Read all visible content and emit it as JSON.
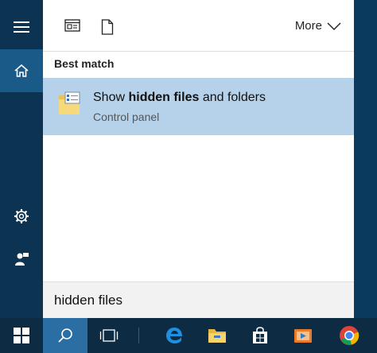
{
  "filters": {
    "apps_icon": "app-window-icon",
    "documents_icon": "document-icon",
    "more_label": "More"
  },
  "best_match": {
    "heading": "Best match",
    "result": {
      "title_prefix": "Show ",
      "title_bold": "hidden files",
      "title_suffix": " and folders",
      "subtitle": "Control panel",
      "icon": "folder-options-icon"
    }
  },
  "search": {
    "query": "hidden files"
  },
  "rail": {
    "items": [
      "hamburger-menu-icon",
      "home-icon",
      "settings-gear-icon",
      "feedback-icon"
    ]
  },
  "taskbar": {
    "items": [
      "windows-start-icon",
      "search-icon",
      "task-view-icon",
      "edge-icon",
      "file-explorer-icon",
      "store-icon",
      "media-player-icon",
      "chrome-icon"
    ]
  },
  "colors": {
    "rail": "#0c3452",
    "rail_selected": "#1a5a89",
    "panel": "#ffffff",
    "result_highlight": "#b6d2ea",
    "taskbar": "#0d2c44",
    "taskbar_active": "#2b6ea3"
  }
}
